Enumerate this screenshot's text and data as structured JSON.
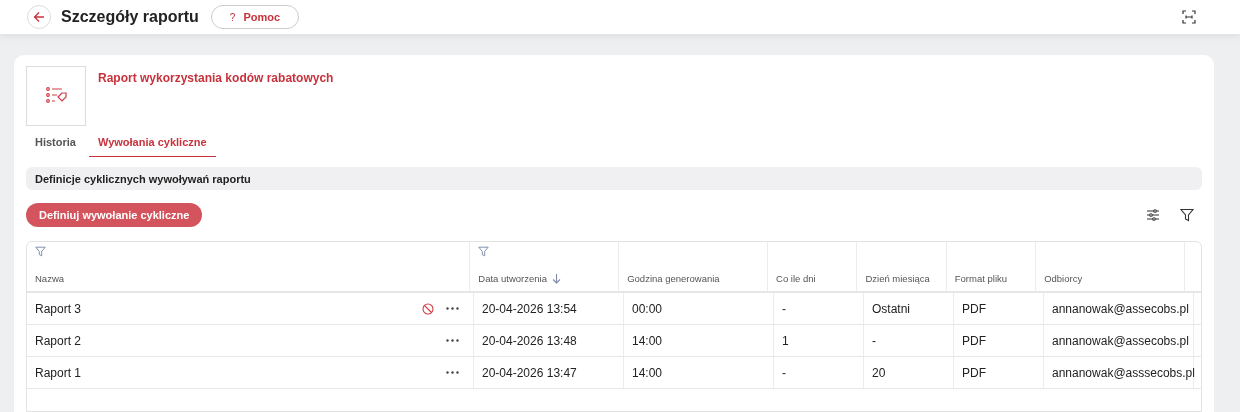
{
  "header": {
    "title": "Szczegóły raportu",
    "help_button": {
      "icon": "?",
      "label": "Pomoc"
    }
  },
  "report": {
    "title": "Raport wykorzystania kodów rabatowych"
  },
  "tabs": [
    {
      "label": "Historia",
      "selected": false
    },
    {
      "label": "Wywołania cykliczne",
      "selected": true
    }
  ],
  "section_title": "Definicje cyklicznych wywoływań raportu",
  "primary_button": "Definiuj wywołanie cykliczne",
  "table": {
    "columns": [
      {
        "label": "Nazwa",
        "filter": true,
        "sorted": false
      },
      {
        "label": "Data utworzenia",
        "filter": true,
        "sorted": true
      },
      {
        "label": "Godzina generowania",
        "filter": false,
        "sorted": false
      },
      {
        "label": "Co ile dni",
        "filter": false,
        "sorted": false
      },
      {
        "label": "Dzień miesiąca",
        "filter": false,
        "sorted": false
      },
      {
        "label": "Format pliku",
        "filter": false,
        "sorted": false
      },
      {
        "label": "Odbiorcy",
        "filter": false,
        "sorted": false
      }
    ],
    "rows": [
      {
        "blocked": true,
        "cells": [
          "Raport 3",
          "20-04-2026 13:54",
          "00:00",
          "-",
          "Ostatni",
          "PDF",
          "annanowak@assecobs.pl"
        ]
      },
      {
        "blocked": false,
        "cells": [
          "Raport 2",
          "20-04-2026 13:48",
          "14:00",
          "1",
          "-",
          "PDF",
          "annanowak@assecobs.pl"
        ]
      },
      {
        "blocked": false,
        "cells": [
          "Raport 1",
          "20-04-2026 13:47",
          "14:00",
          "-",
          "20",
          "PDF",
          "annanowak@asssecobs.pl"
        ]
      }
    ]
  }
}
